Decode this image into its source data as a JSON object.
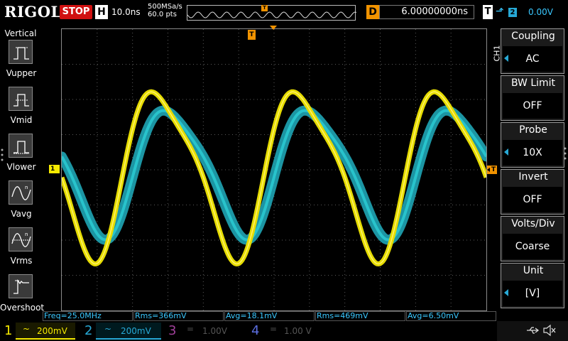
{
  "top": {
    "logo": "RIGOL",
    "run_state": "STOP",
    "h_label": "H",
    "timebase": "10.0ns",
    "sample_rate": "500MSa/s",
    "points": "60.0 pts",
    "trigger_pos_label": "T",
    "d_label": "D",
    "delay": "6.00000000ns",
    "t_label": "T",
    "trigger_source": "2",
    "trigger_level": "0.00V"
  },
  "left_menu": {
    "title": "Vertical",
    "items": [
      {
        "label": "Vupper",
        "icon": "vupper-icon"
      },
      {
        "label": "Vmid",
        "icon": "vmid-icon"
      },
      {
        "label": "Vlower",
        "icon": "vlower-icon"
      },
      {
        "label": "Vavg",
        "icon": "vavg-icon"
      },
      {
        "label": "Vrms",
        "icon": "vrms-icon"
      },
      {
        "label": "Overshoot",
        "icon": "overshoot-icon"
      }
    ]
  },
  "markers": {
    "trig_pos": "T",
    "ch1": "1",
    "trig_level": "T"
  },
  "right_menu": {
    "channel": "CH1",
    "items": [
      {
        "title": "Coupling",
        "value": "AC",
        "arrow": true
      },
      {
        "title": "BW Limit",
        "value": "OFF",
        "arrow": false
      },
      {
        "title": "Probe",
        "value": "10X",
        "arrow": true
      },
      {
        "title": "Invert",
        "value": "OFF",
        "arrow": false
      },
      {
        "title": "Volts/Div",
        "value": "Coarse",
        "arrow": false
      },
      {
        "title": "Unit",
        "value": "[V]",
        "arrow": true
      }
    ]
  },
  "measurements": [
    "Freq=25.0MHz",
    "Rms=366mV",
    "Avg=18.1mV",
    "Rms=469mV",
    "Avg=6.50mV"
  ],
  "channels": [
    {
      "num": "1",
      "coupling": "~",
      "scale": "200mV",
      "color": "#f5ea00",
      "active": true
    },
    {
      "num": "2",
      "coupling": "~",
      "scale": "200mV",
      "color": "#27a9d6",
      "active": true
    },
    {
      "num": "3",
      "coupling": "=",
      "scale": "1.00V",
      "color": "#a0409a",
      "active": false
    },
    {
      "num": "4",
      "coupling": "=",
      "scale": "1.00 V",
      "color": "#5b6ee0",
      "active": false
    }
  ],
  "colors": {
    "ch1": "#f5ea00",
    "ch2": "#27a9d6",
    "trigger": "#f19300",
    "stop": "#d01010"
  },
  "waveforms": {
    "frequency_mhz": 25.0,
    "ch1_peak_divs": 2.6,
    "ch2_peak_divs": 1.95,
    "ch1_phase_divs": 0.0,
    "ch2_phase_divs": -0.3
  }
}
